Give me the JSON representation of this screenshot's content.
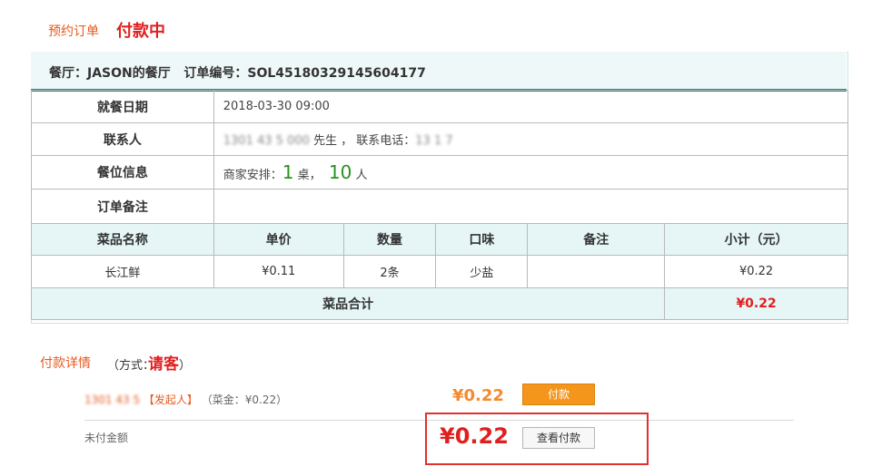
{
  "header": {
    "label": "预约订单",
    "status": "付款中"
  },
  "order": {
    "restaurant_label": "餐厅：",
    "restaurant_name": "JASON的餐厅",
    "order_no_label": "订单编号：",
    "order_no": "SOL45180329145604177"
  },
  "info": {
    "date_label": "就餐日期",
    "date_value": "2018-03-30  09:00",
    "contact_label": "联系人",
    "contact_name": "1301 43 5 000",
    "contact_suffix": "先生  ，  联系电话：",
    "contact_phone": "13 1  7",
    "seat_label": "餐位信息",
    "seat_prefix": "商家安排：",
    "seat_tables": "1",
    "seat_tables_unit": "桌，",
    "seat_people": "10",
    "seat_people_unit": "人",
    "note_label": "订单备注",
    "note_value": ""
  },
  "dishes": {
    "headers": [
      "菜品名称",
      "单价",
      "数量",
      "口味",
      "备注",
      "小计（元）"
    ],
    "rows": [
      {
        "name": "长江鲜",
        "price": "¥0.11",
        "qty": "2条",
        "taste": "少盐",
        "note": "",
        "subtotal": "¥0.22"
      }
    ],
    "total_label": "菜品合计",
    "total_value": "¥0.22"
  },
  "payment": {
    "title": "付款详情",
    "method_label": "（方式：",
    "method_value": "请客",
    "method_close": "）",
    "payer_name": "1301 43 5",
    "payer_role": "【发起人】",
    "payer_detail": "（菜金：¥0.22）",
    "payer_amount": "¥0.22",
    "pay_button": "付款",
    "unpaid_label": "未付金额",
    "unpaid_amount": "¥0.22",
    "view_button": "查看付款"
  },
  "colors": {
    "accent_orange": "#e8581f",
    "status_red": "#e02020",
    "teal": "#1f8a76",
    "number_green": "#2a9020",
    "pay_button": "#f4961c"
  }
}
